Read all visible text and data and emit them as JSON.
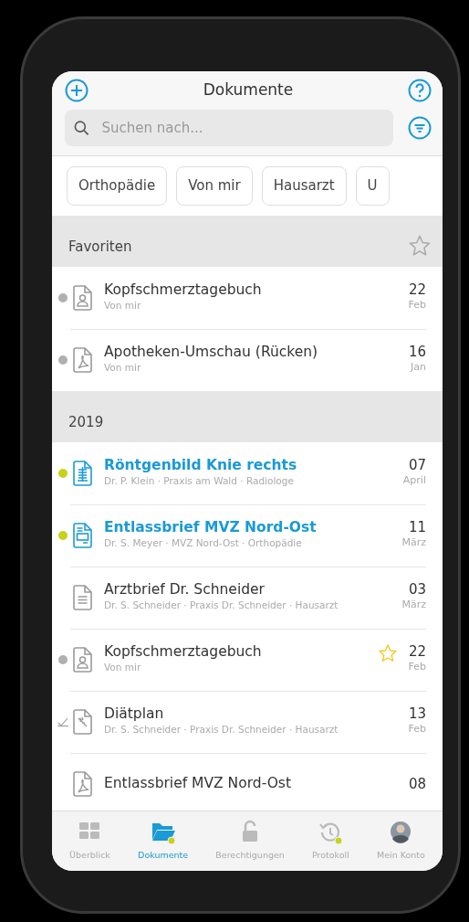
{
  "header": {
    "title": "Dokumente"
  },
  "search": {
    "placeholder": "Suchen nach..."
  },
  "chips": [
    {
      "label": "Orthopädie"
    },
    {
      "label": "Von mir"
    },
    {
      "label": "Hausarzt"
    },
    {
      "label": "U"
    }
  ],
  "sections": [
    {
      "title": "Favoriten",
      "star_header": true,
      "items": [
        {
          "kind": "person",
          "marker": {
            "kind": "dot",
            "color": "#b0b0b0"
          },
          "unread": false,
          "favorite": false,
          "title": "Kopfschmerztagebuch",
          "subtitle": "Von mir",
          "day": "22",
          "month": "Feb"
        },
        {
          "kind": "pdf",
          "marker": {
            "kind": "dot",
            "color": "#b0b0b0"
          },
          "unread": false,
          "favorite": false,
          "title": "Apotheken-Umschau (Rücken)",
          "subtitle": "Von mir",
          "day": "16",
          "month": "Jan"
        }
      ]
    },
    {
      "title": "2019",
      "star_header": false,
      "items": [
        {
          "kind": "xray",
          "marker": {
            "kind": "dot",
            "color": "#c7d21a"
          },
          "unread": true,
          "favorite": false,
          "title": "Röntgenbild Knie rechts",
          "subtitle": "Dr. P. Klein · Praxis am Wald · Radiologe",
          "day": "07",
          "month": "April"
        },
        {
          "kind": "form",
          "marker": {
            "kind": "dot",
            "color": "#c7d21a"
          },
          "unread": true,
          "favorite": false,
          "title": "Entlassbrief MVZ Nord-Ost",
          "subtitle": "Dr. S. Meyer · MVZ Nord-Ost · Orthopädie",
          "day": "11",
          "month": "März"
        },
        {
          "kind": "text",
          "unread": false,
          "favorite": false,
          "title": "Arztbrief Dr. Schneider",
          "subtitle": "Dr. S. Schneider · Praxis Dr. Schneider · Hausarzt",
          "day": "03",
          "month": "März"
        },
        {
          "kind": "person",
          "marker": {
            "kind": "dot",
            "color": "#b0b0b0"
          },
          "unread": false,
          "favorite": true,
          "title": "Kopfschmerztagebuch",
          "subtitle": "Von mir",
          "day": "22",
          "month": "Feb"
        },
        {
          "kind": "plant",
          "marker": {
            "kind": "check"
          },
          "unread": false,
          "favorite": false,
          "title": "Diätplan",
          "subtitle": "Dr. S. Schneider · Praxis Dr. Schneider · Hausarzt",
          "day": "13",
          "month": "Feb"
        },
        {
          "kind": "pdf",
          "unread": false,
          "favorite": false,
          "title": "Entlassbrief MVZ Nord-Ost",
          "day": "08"
        }
      ]
    }
  ],
  "tabbar": [
    {
      "kind": "grid",
      "label": "Überblick",
      "selected": false,
      "badge": false
    },
    {
      "kind": "folder",
      "label": "Dokumente",
      "selected": true,
      "badge": true
    },
    {
      "kind": "lock",
      "label": "Berechtigungen",
      "selected": false,
      "badge": false
    },
    {
      "kind": "history",
      "label": "Protokoll",
      "selected": false,
      "badge": true
    },
    {
      "kind": "avatar",
      "label": "Mein Konto",
      "selected": false,
      "badge": false
    }
  ]
}
